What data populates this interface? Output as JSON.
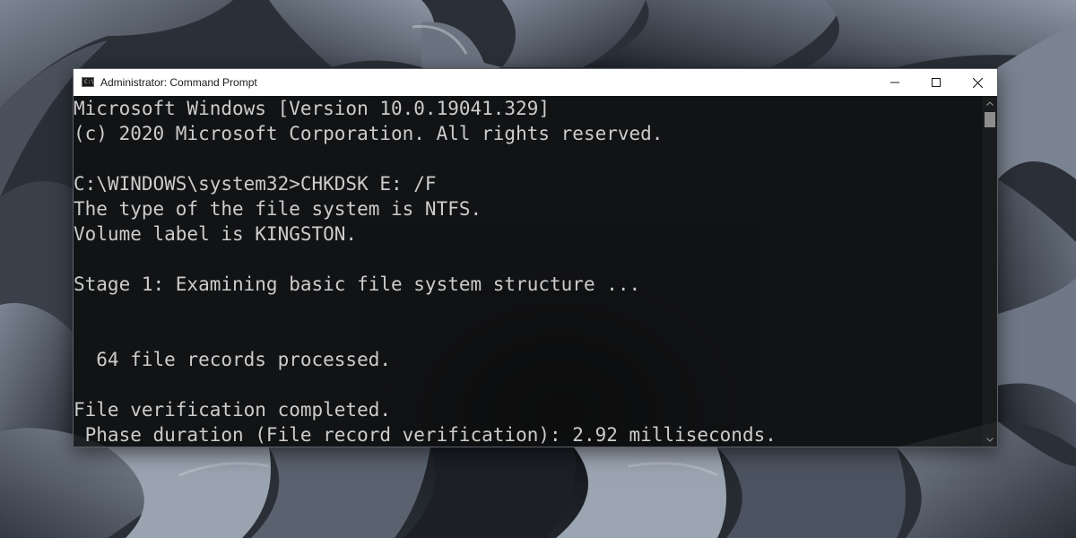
{
  "window": {
    "title": "Administrator: Command Prompt",
    "app_icon": "cmd-console-icon",
    "controls": {
      "minimize": "minimize-icon",
      "maximize": "maximize-icon",
      "close": "close-icon"
    }
  },
  "console": {
    "text_color": "#cccccc",
    "background": "#0c0c0c",
    "lines": [
      "Microsoft Windows [Version 10.0.19041.329]",
      "(c) 2020 Microsoft Corporation. All rights reserved.",
      "",
      "C:\\WINDOWS\\system32>CHKDSK E: /F",
      "The type of the file system is NTFS.",
      "Volume label is KINGSTON.",
      "",
      "Stage 1: Examining basic file system structure ...",
      "",
      "",
      "  64 file records processed.",
      "",
      "File verification completed.",
      " Phase duration (File record verification): 2.92 milliseconds."
    ]
  },
  "scrollbar": {
    "position": 0.0,
    "up_icon": "chevron-up-icon",
    "down_icon": "chevron-down-icon"
  },
  "wallpaper": "agave-plant-wallpaper"
}
